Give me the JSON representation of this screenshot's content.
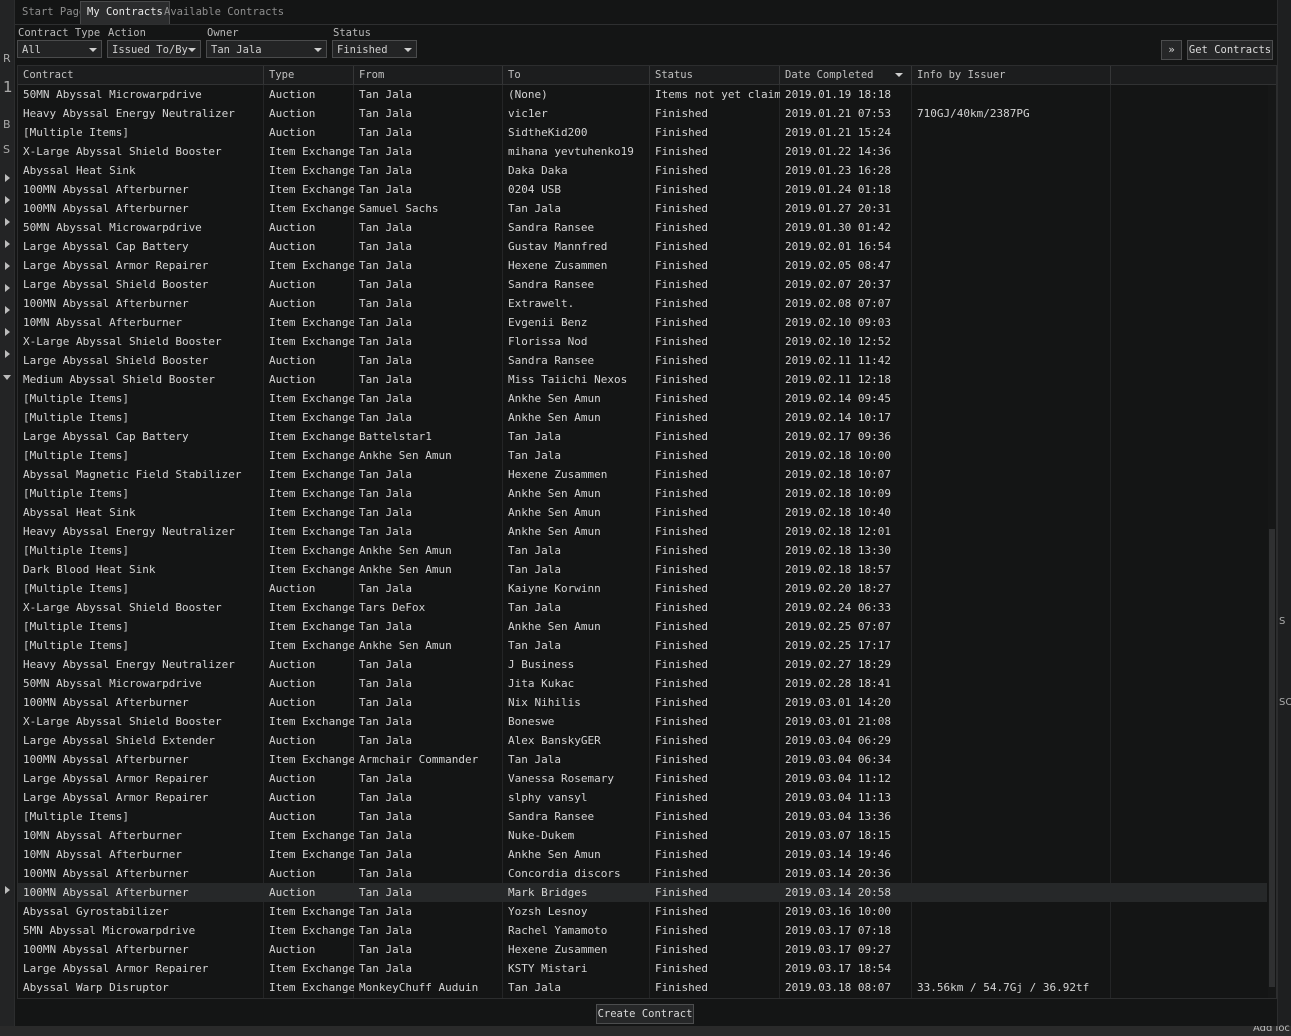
{
  "tabs": [
    "Start Page",
    "My Contracts",
    "Available Contracts"
  ],
  "active_tab": "My Contracts",
  "filters": {
    "contract_type": {
      "label": "Contract Type",
      "value": "All"
    },
    "action": {
      "label": "Action",
      "value": "Issued To/By"
    },
    "owner": {
      "label": "Owner",
      "value": "Tan Jala"
    },
    "status": {
      "label": "Status",
      "value": "Finished"
    }
  },
  "get_contracts_label": "Get Contracts",
  "create_contract_label": "Create Contract",
  "background_text": {
    "left": [
      "R",
      "1",
      "B",
      "S"
    ],
    "right": [
      "S",
      "SO"
    ],
    "bottom_right": "Add loc"
  },
  "columns": [
    "Contract",
    "Type",
    "From",
    "To",
    "Status",
    "Date Completed",
    "Info by Issuer"
  ],
  "sorted_column": "Date Completed",
  "selected_row": 42,
  "rows": [
    [
      "50MN Abyssal Microwarpdrive",
      "Auction",
      "Tan Jala",
      "(None)",
      "Items not yet claimed",
      "2019.01.19 18:18",
      ""
    ],
    [
      "Heavy Abyssal Energy Neutralizer",
      "Auction",
      "Tan Jala",
      "vic1er",
      "Finished",
      "2019.01.21 07:53",
      "710GJ/40km/2387PG"
    ],
    [
      "[Multiple Items]",
      "Auction",
      "Tan Jala",
      "SidtheKid200",
      "Finished",
      "2019.01.21 15:24",
      ""
    ],
    [
      "X-Large Abyssal Shield Booster",
      "Item Exchange",
      "Tan Jala",
      "mihana yevtuhenko19",
      "Finished",
      "2019.01.22 14:36",
      ""
    ],
    [
      "Abyssal Heat Sink",
      "Item Exchange",
      "Tan Jala",
      "Daka Daka",
      "Finished",
      "2019.01.23 16:28",
      ""
    ],
    [
      "100MN Abyssal Afterburner",
      "Item Exchange",
      "Tan Jala",
      "0204 USB",
      "Finished",
      "2019.01.24 01:18",
      ""
    ],
    [
      "100MN Abyssal Afterburner",
      "Item Exchange",
      "Samuel Sachs",
      "Tan Jala",
      "Finished",
      "2019.01.27 20:31",
      ""
    ],
    [
      "50MN Abyssal Microwarpdrive",
      "Auction",
      "Tan Jala",
      "Sandra Ransee",
      "Finished",
      "2019.01.30 01:42",
      ""
    ],
    [
      "Large Abyssal Cap Battery",
      "Auction",
      "Tan Jala",
      "Gustav Mannfred",
      "Finished",
      "2019.02.01 16:54",
      ""
    ],
    [
      "Large Abyssal Armor Repairer",
      "Item Exchange",
      "Tan Jala",
      "Hexene Zusammen",
      "Finished",
      "2019.02.05 08:47",
      ""
    ],
    [
      "Large Abyssal Shield Booster",
      "Auction",
      "Tan Jala",
      "Sandra Ransee",
      "Finished",
      "2019.02.07 20:37",
      ""
    ],
    [
      "100MN Abyssal Afterburner",
      "Auction",
      "Tan Jala",
      "Extrawelt.",
      "Finished",
      "2019.02.08 07:07",
      ""
    ],
    [
      "10MN Abyssal Afterburner",
      "Item Exchange",
      "Tan Jala",
      "Evgenii Benz",
      "Finished",
      "2019.02.10 09:03",
      ""
    ],
    [
      "X-Large Abyssal Shield Booster",
      "Item Exchange",
      "Tan Jala",
      "Florissa Nod",
      "Finished",
      "2019.02.10 12:52",
      ""
    ],
    [
      "Large Abyssal Shield Booster",
      "Auction",
      "Tan Jala",
      "Sandra Ransee",
      "Finished",
      "2019.02.11 11:42",
      ""
    ],
    [
      "Medium Abyssal Shield Booster",
      "Auction",
      "Tan Jala",
      "Miss Taiichi Nexos",
      "Finished",
      "2019.02.11 12:18",
      ""
    ],
    [
      "[Multiple Items]",
      "Item Exchange",
      "Tan Jala",
      "Ankhe Sen Amun",
      "Finished",
      "2019.02.14 09:45",
      ""
    ],
    [
      "[Multiple Items]",
      "Item Exchange",
      "Tan Jala",
      "Ankhe Sen Amun",
      "Finished",
      "2019.02.14 10:17",
      ""
    ],
    [
      "Large Abyssal Cap Battery",
      "Item Exchange",
      "Battelstar1",
      "Tan Jala",
      "Finished",
      "2019.02.17 09:36",
      ""
    ],
    [
      "[Multiple Items]",
      "Item Exchange",
      "Ankhe Sen Amun",
      "Tan Jala",
      "Finished",
      "2019.02.18 10:00",
      ""
    ],
    [
      "Abyssal Magnetic Field Stabilizer",
      "Item Exchange",
      "Tan Jala",
      "Hexene Zusammen",
      "Finished",
      "2019.02.18 10:07",
      ""
    ],
    [
      "[Multiple Items]",
      "Item Exchange",
      "Tan Jala",
      "Ankhe Sen Amun",
      "Finished",
      "2019.02.18 10:09",
      ""
    ],
    [
      "Abyssal Heat Sink",
      "Item Exchange",
      "Tan Jala",
      "Ankhe Sen Amun",
      "Finished",
      "2019.02.18 10:40",
      ""
    ],
    [
      "Heavy Abyssal Energy Neutralizer",
      "Item Exchange",
      "Tan Jala",
      "Ankhe Sen Amun",
      "Finished",
      "2019.02.18 12:01",
      ""
    ],
    [
      "[Multiple Items]",
      "Item Exchange",
      "Ankhe Sen Amun",
      "Tan Jala",
      "Finished",
      "2019.02.18 13:30",
      ""
    ],
    [
      "Dark Blood Heat Sink",
      "Item Exchange",
      "Ankhe Sen Amun",
      "Tan Jala",
      "Finished",
      "2019.02.18 18:57",
      ""
    ],
    [
      "[Multiple Items]",
      "Auction",
      "Tan Jala",
      "Kaiyne Korwinn",
      "Finished",
      "2019.02.20 18:27",
      ""
    ],
    [
      "X-Large Abyssal Shield Booster",
      "Item Exchange",
      "Tars DeFox",
      "Tan Jala",
      "Finished",
      "2019.02.24 06:33",
      ""
    ],
    [
      "[Multiple Items]",
      "Item Exchange",
      "Tan Jala",
      "Ankhe Sen Amun",
      "Finished",
      "2019.02.25 07:07",
      ""
    ],
    [
      "[Multiple Items]",
      "Item Exchange",
      "Ankhe Sen Amun",
      "Tan Jala",
      "Finished",
      "2019.02.25 17:17",
      ""
    ],
    [
      "Heavy Abyssal Energy Neutralizer",
      "Auction",
      "Tan Jala",
      "J Business",
      "Finished",
      "2019.02.27 18:29",
      ""
    ],
    [
      "50MN Abyssal Microwarpdrive",
      "Auction",
      "Tan Jala",
      "Jita Kukac",
      "Finished",
      "2019.02.28 18:41",
      ""
    ],
    [
      "100MN Abyssal Afterburner",
      "Auction",
      "Tan Jala",
      "Nix Nihilis",
      "Finished",
      "2019.03.01 14:20",
      ""
    ],
    [
      "X-Large Abyssal Shield Booster",
      "Item Exchange",
      "Tan Jala",
      "Boneswe",
      "Finished",
      "2019.03.01 21:08",
      ""
    ],
    [
      "Large Abyssal Shield Extender",
      "Auction",
      "Tan Jala",
      "Alex BanskyGER",
      "Finished",
      "2019.03.04 06:29",
      ""
    ],
    [
      "100MN Abyssal Afterburner",
      "Item Exchange",
      "Armchair Commander",
      "Tan Jala",
      "Finished",
      "2019.03.04 06:34",
      ""
    ],
    [
      "Large Abyssal Armor Repairer",
      "Auction",
      "Tan Jala",
      "Vanessa Rosemary",
      "Finished",
      "2019.03.04 11:12",
      ""
    ],
    [
      "Large Abyssal Armor Repairer",
      "Auction",
      "Tan Jala",
      "slphy vansyl",
      "Finished",
      "2019.03.04 11:13",
      ""
    ],
    [
      "[Multiple Items]",
      "Auction",
      "Tan Jala",
      "Sandra Ransee",
      "Finished",
      "2019.03.04 13:36",
      ""
    ],
    [
      "10MN Abyssal Afterburner",
      "Item Exchange",
      "Tan Jala",
      "Nuke-Dukem",
      "Finished",
      "2019.03.07 18:15",
      ""
    ],
    [
      "10MN Abyssal Afterburner",
      "Item Exchange",
      "Tan Jala",
      "Ankhe Sen Amun",
      "Finished",
      "2019.03.14 19:46",
      ""
    ],
    [
      "100MN Abyssal Afterburner",
      "Auction",
      "Tan Jala",
      "Concordia discors",
      "Finished",
      "2019.03.14 20:36",
      ""
    ],
    [
      "100MN Abyssal Afterburner",
      "Auction",
      "Tan Jala",
      "Mark Bridges",
      "Finished",
      "2019.03.14 20:58",
      ""
    ],
    [
      "Abyssal Gyrostabilizer",
      "Item Exchange",
      "Tan Jala",
      "Yozsh Lesnoy",
      "Finished",
      "2019.03.16 10:00",
      ""
    ],
    [
      "5MN Abyssal Microwarpdrive",
      "Item Exchange",
      "Tan Jala",
      "Rachel Yamamoto",
      "Finished",
      "2019.03.17 07:18",
      ""
    ],
    [
      "100MN Abyssal Afterburner",
      "Auction",
      "Tan Jala",
      "Hexene Zusammen",
      "Finished",
      "2019.03.17 09:27",
      ""
    ],
    [
      "Large Abyssal Armor Repairer",
      "Item Exchange",
      "Tan Jala",
      "KSTY Mistari",
      "Finished",
      "2019.03.17 18:54",
      ""
    ],
    [
      "Abyssal Warp Disruptor",
      "Item Exchange",
      "MonkeyChuff Auduin",
      "Tan Jala",
      "Finished",
      "2019.03.18 08:07",
      "33.56km / 54.7Gj / 36.92tf"
    ]
  ]
}
